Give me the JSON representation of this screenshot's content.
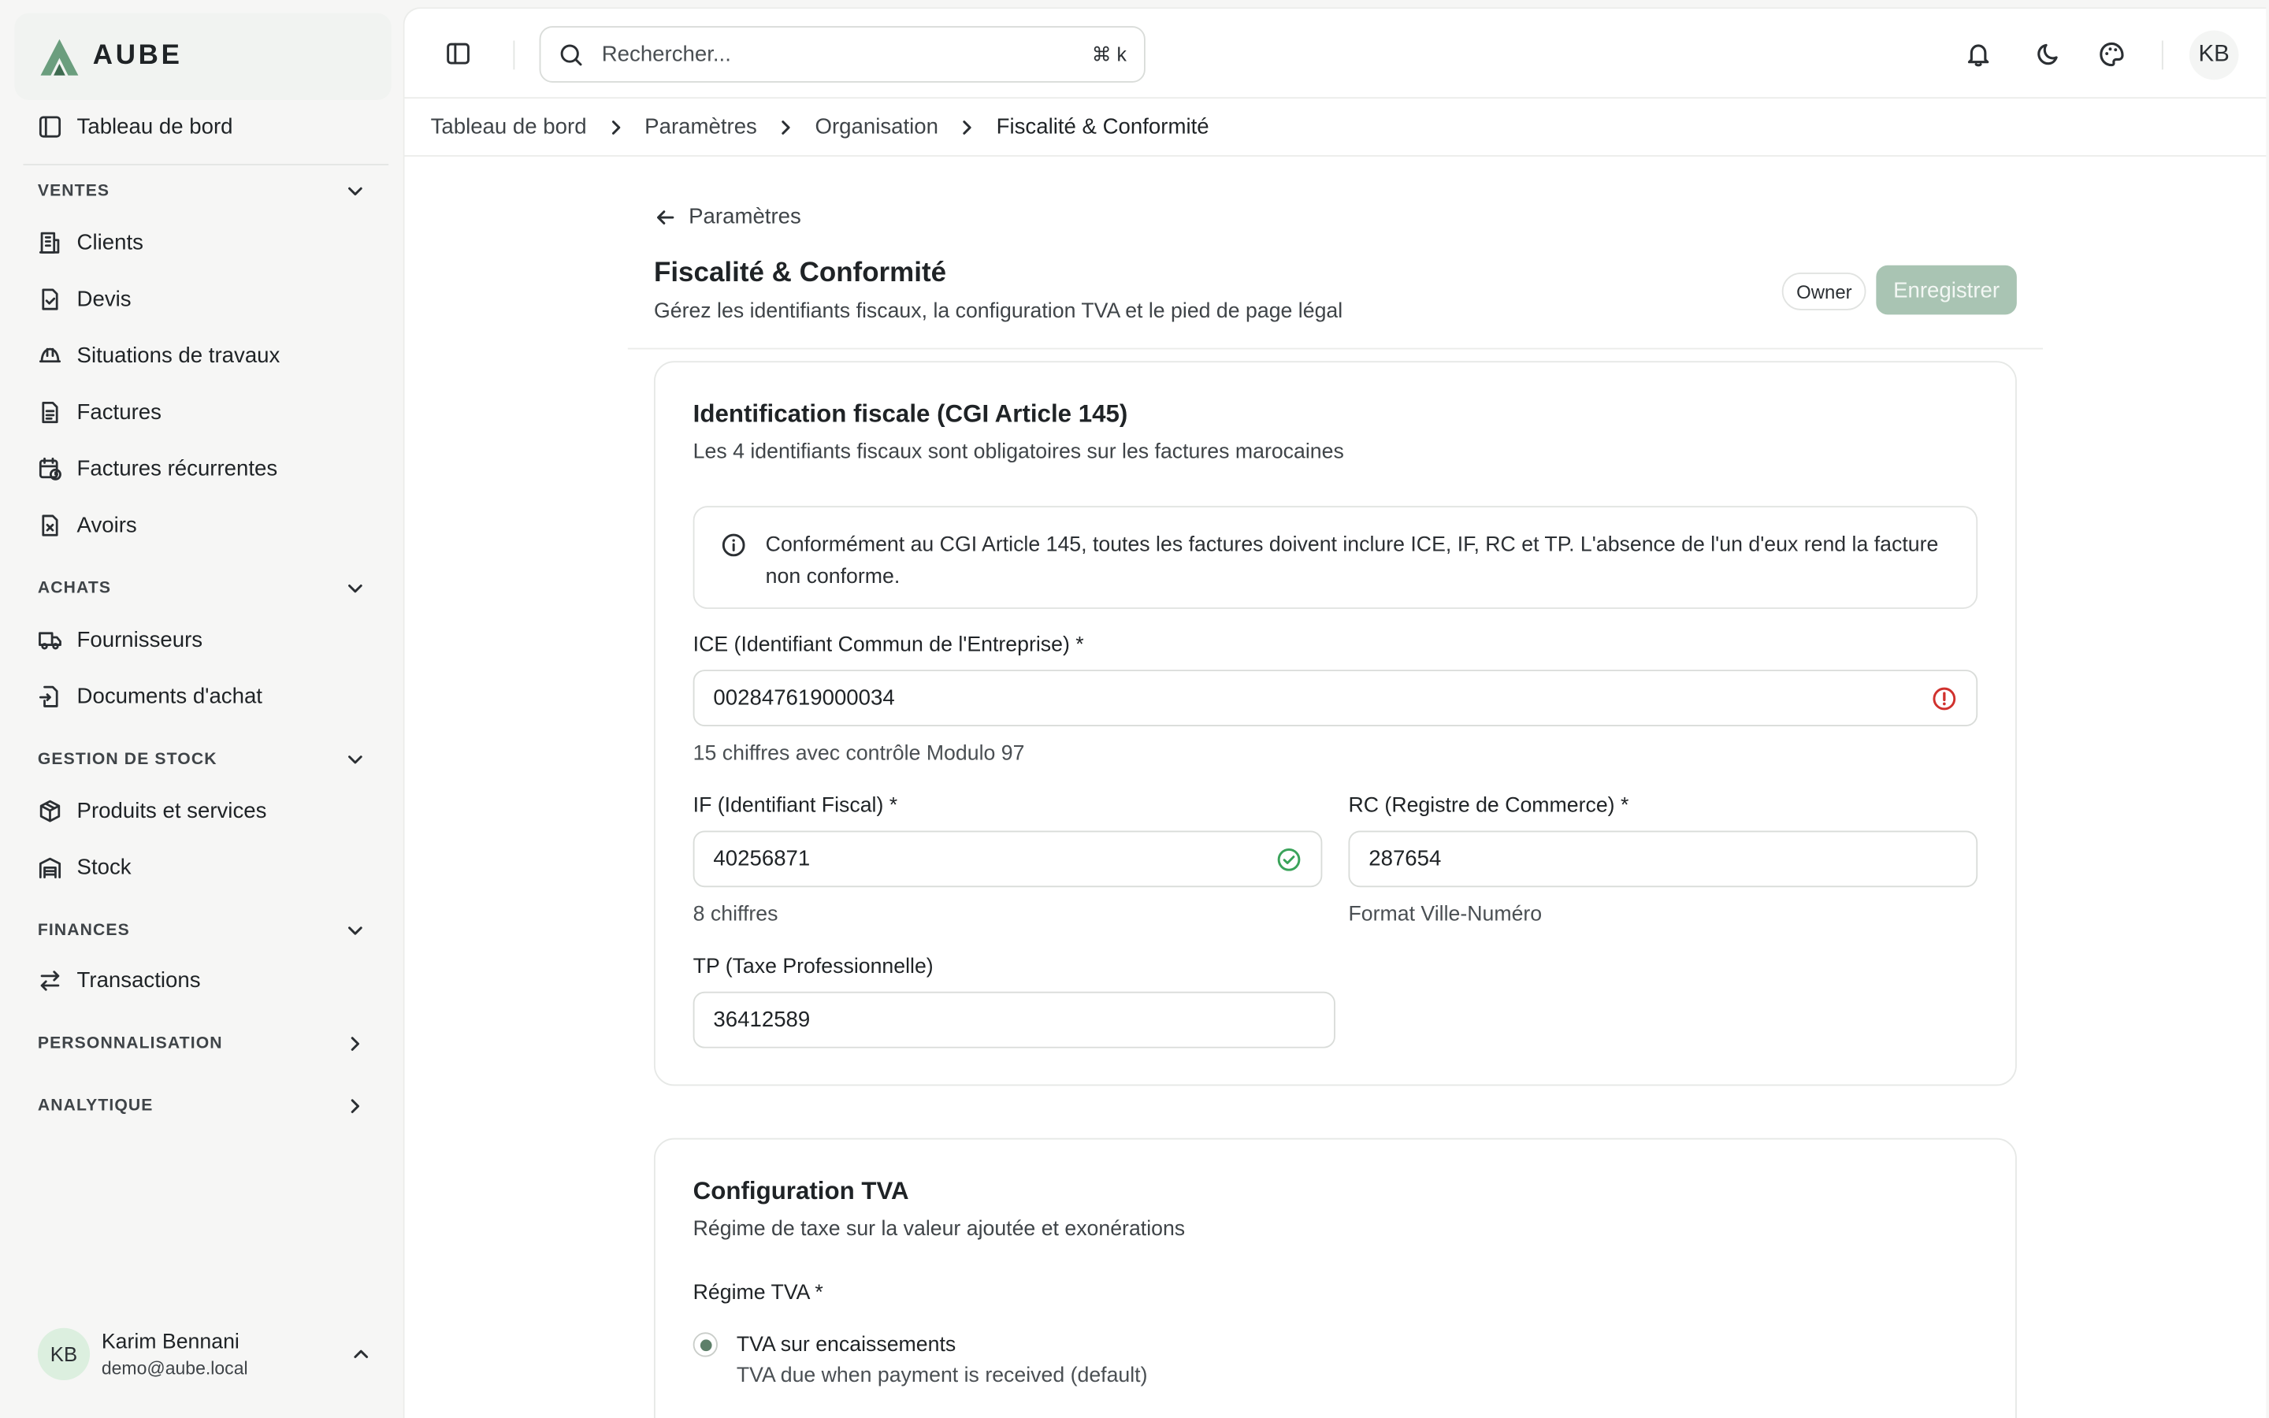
{
  "brand": {
    "name": "AUBE",
    "accent": "#6b9e7e"
  },
  "sidebar": {
    "dashboard": "Tableau de bord",
    "sections": {
      "ventes": {
        "label": "VENTES",
        "items": [
          "Clients",
          "Devis",
          "Situations de travaux",
          "Factures",
          "Factures récurrentes",
          "Avoirs"
        ]
      },
      "achats": {
        "label": "ACHATS",
        "items": [
          "Fournisseurs",
          "Documents d'achat"
        ]
      },
      "stock": {
        "label": "GESTION DE STOCK",
        "items": [
          "Produits et services",
          "Stock"
        ]
      },
      "finances": {
        "label": "FINANCES",
        "items": [
          "Transactions"
        ]
      },
      "perso": {
        "label": "PERSONNALISATION"
      },
      "analytique": {
        "label": "ANALYTIQUE"
      }
    },
    "user": {
      "initials": "KB",
      "name": "Karim Bennani",
      "email": "demo@aube.local"
    }
  },
  "topbar": {
    "search_placeholder": "Rechercher...",
    "shortcut": "⌘ k",
    "avatar_initials": "KB"
  },
  "breadcrumb": [
    "Tableau de bord",
    "Paramètres",
    "Organisation",
    "Fiscalité & Conformité"
  ],
  "page": {
    "back_label": "Paramètres",
    "title": "Fiscalité & Conformité",
    "subtitle": "Gérez les identifiants fiscaux, la configuration TVA et le pied de page légal",
    "role_badge": "Owner",
    "save_label": "Enregistrer"
  },
  "fiscal_card": {
    "title": "Identification fiscale (CGI Article 145)",
    "subtitle": "Les 4 identifiants fiscaux sont obligatoires sur les factures marocaines",
    "alert_line1": "Conformément au CGI Article 145, toutes les factures doivent inclure ICE, IF, RC et TP. L'absence de l'un d'eux rend la facture",
    "alert_line2": "non conforme.",
    "ice": {
      "label": "ICE (Identifiant Commun de l'Entreprise) *",
      "value": "002847619000034",
      "hint": "15 chiffres avec contrôle Modulo 97",
      "status": "error"
    },
    "if": {
      "label": "IF (Identifiant Fiscal) *",
      "value": "40256871",
      "hint": "8 chiffres",
      "status": "valid"
    },
    "rc": {
      "label": "RC (Registre de Commerce) *",
      "value": "287654",
      "hint": "Format Ville-Numéro"
    },
    "tp": {
      "label": "TP (Taxe Professionnelle)",
      "value": "36412589"
    }
  },
  "tva_card": {
    "title": "Configuration TVA",
    "subtitle": "Régime de taxe sur la valeur ajoutée et exonérations",
    "regime_label": "Régime TVA *",
    "option1_label": "TVA sur encaissements",
    "option1_desc": "TVA due when payment is received (default)"
  },
  "colors": {
    "error": "#d0312d",
    "valid": "#3aa35a",
    "save_disabled": "#a9c4b3"
  }
}
